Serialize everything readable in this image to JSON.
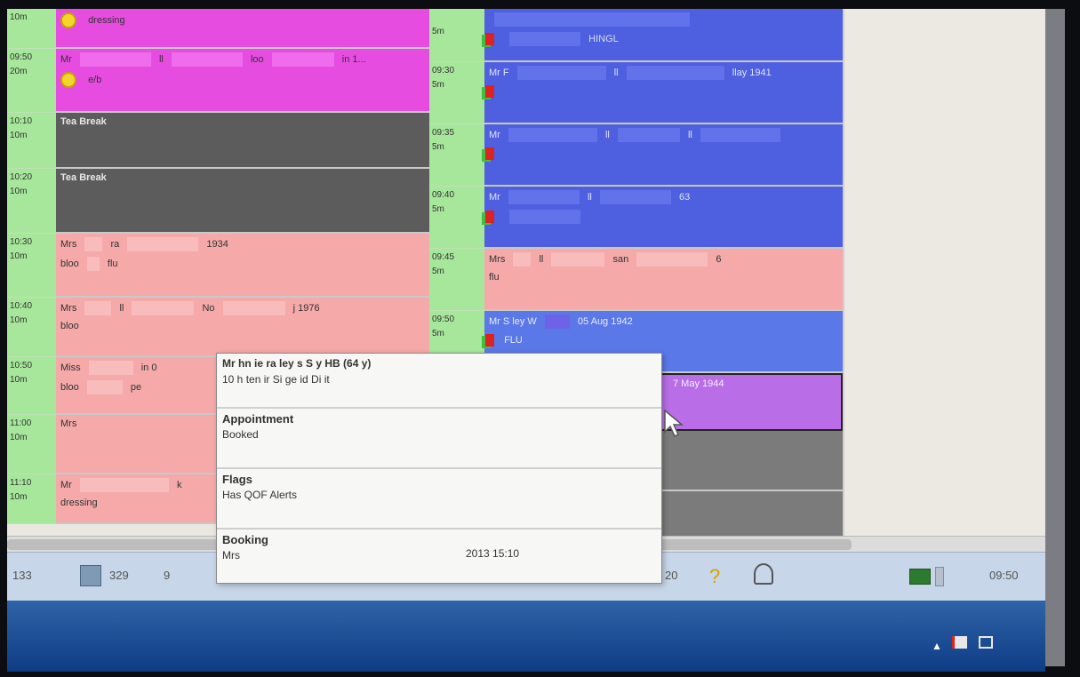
{
  "left_column": {
    "times": [
      {
        "time": "",
        "duration": "10m"
      },
      {
        "time": "09:50",
        "duration": "20m"
      },
      {
        "time": "10:10",
        "duration": "10m"
      },
      {
        "time": "10:20",
        "duration": "10m"
      },
      {
        "time": "10:30",
        "duration": "10m"
      },
      {
        "time": "10:40",
        "duration": "10m"
      },
      {
        "time": "10:50",
        "duration": "10m"
      },
      {
        "time": "11:00",
        "duration": "10m"
      },
      {
        "time": "11:10",
        "duration": "10m"
      }
    ],
    "slots": [
      {
        "line1": "dressing",
        "line2": ""
      },
      {
        "line1": "Mr",
        "line1_b": "ll",
        "line1_c": "loo",
        "line1_d": "in 1...",
        "line2": "e/b"
      },
      {
        "line1": "Tea Break",
        "line2": ""
      },
      {
        "line1": "Tea Break",
        "line2": ""
      },
      {
        "line1": "Mrs",
        "line1_b": "ra",
        "line1_c": "1934",
        "line2": "bloo",
        "line2_b": "flu"
      },
      {
        "line1": "Mrs",
        "line1_b": "ll",
        "line1_c": "No",
        "line1_d": "j 1976",
        "line2": "bloo"
      },
      {
        "line1": "Miss",
        "line1_b": "in 0",
        "line2": "bloo",
        "line2_b": "pe"
      },
      {
        "line1": "Mrs",
        "line2": ""
      },
      {
        "line1": "Mr",
        "line1_b": "k",
        "line2": "dressing"
      }
    ]
  },
  "right_column": {
    "times": [
      {
        "time": "",
        "duration": "5m"
      },
      {
        "time": "09:30",
        "duration": "5m"
      },
      {
        "time": "09:35",
        "duration": "5m"
      },
      {
        "time": "09:40",
        "duration": "5m"
      },
      {
        "time": "09:45",
        "duration": "5m"
      },
      {
        "time": "09:50",
        "duration": "5m"
      }
    ],
    "slots": [
      {
        "line1": "",
        "line2": "HINGL"
      },
      {
        "line1": "Mr F",
        "line1_b": "ll",
        "line1_c": "llay 1941",
        "line2": ""
      },
      {
        "line1": "Mr",
        "line1_b": "ll",
        "line1_c": "ll",
        "line2": ""
      },
      {
        "line1": "Mr",
        "line1_b": "ll",
        "line1_c": "63",
        "line2": ""
      },
      {
        "line1": "Mrs",
        "line1_b": "ll",
        "line1_c": "san",
        "line1_d": "6",
        "line2": "flu"
      },
      {
        "line1": "Mr S",
        "line1_b": "ley W",
        "line1_c": "05 Aug 1942",
        "line2": "FLU"
      },
      {
        "line1": "7 May 1944",
        "line2": ""
      }
    ]
  },
  "tooltip": {
    "name_line": "Mr  hn  ie  ra  ley  s  S  y  HB (64 y)",
    "address_line": "10 h  ten  ir  Si  ge  id  Di  it",
    "appointment_heading": "Appointment",
    "appointment_value": "Booked",
    "flags_heading": "Flags",
    "flags_value": "Has QOF Alerts",
    "booking_heading": "Booking",
    "booking_by": "Mrs",
    "booking_time": "2013 15:10"
  },
  "taskbar": {
    "item1": "133",
    "item2": "329",
    "item3": "9",
    "item4": "20",
    "clock": "09:50"
  },
  "colors": {
    "time_column": "#a7e79b",
    "magenta": "#e64ce0",
    "grey_break": "#5c5c5c",
    "salmon": "#f5a9a9",
    "blue": "#4e5fe0",
    "lilac": "#b96ee8"
  }
}
